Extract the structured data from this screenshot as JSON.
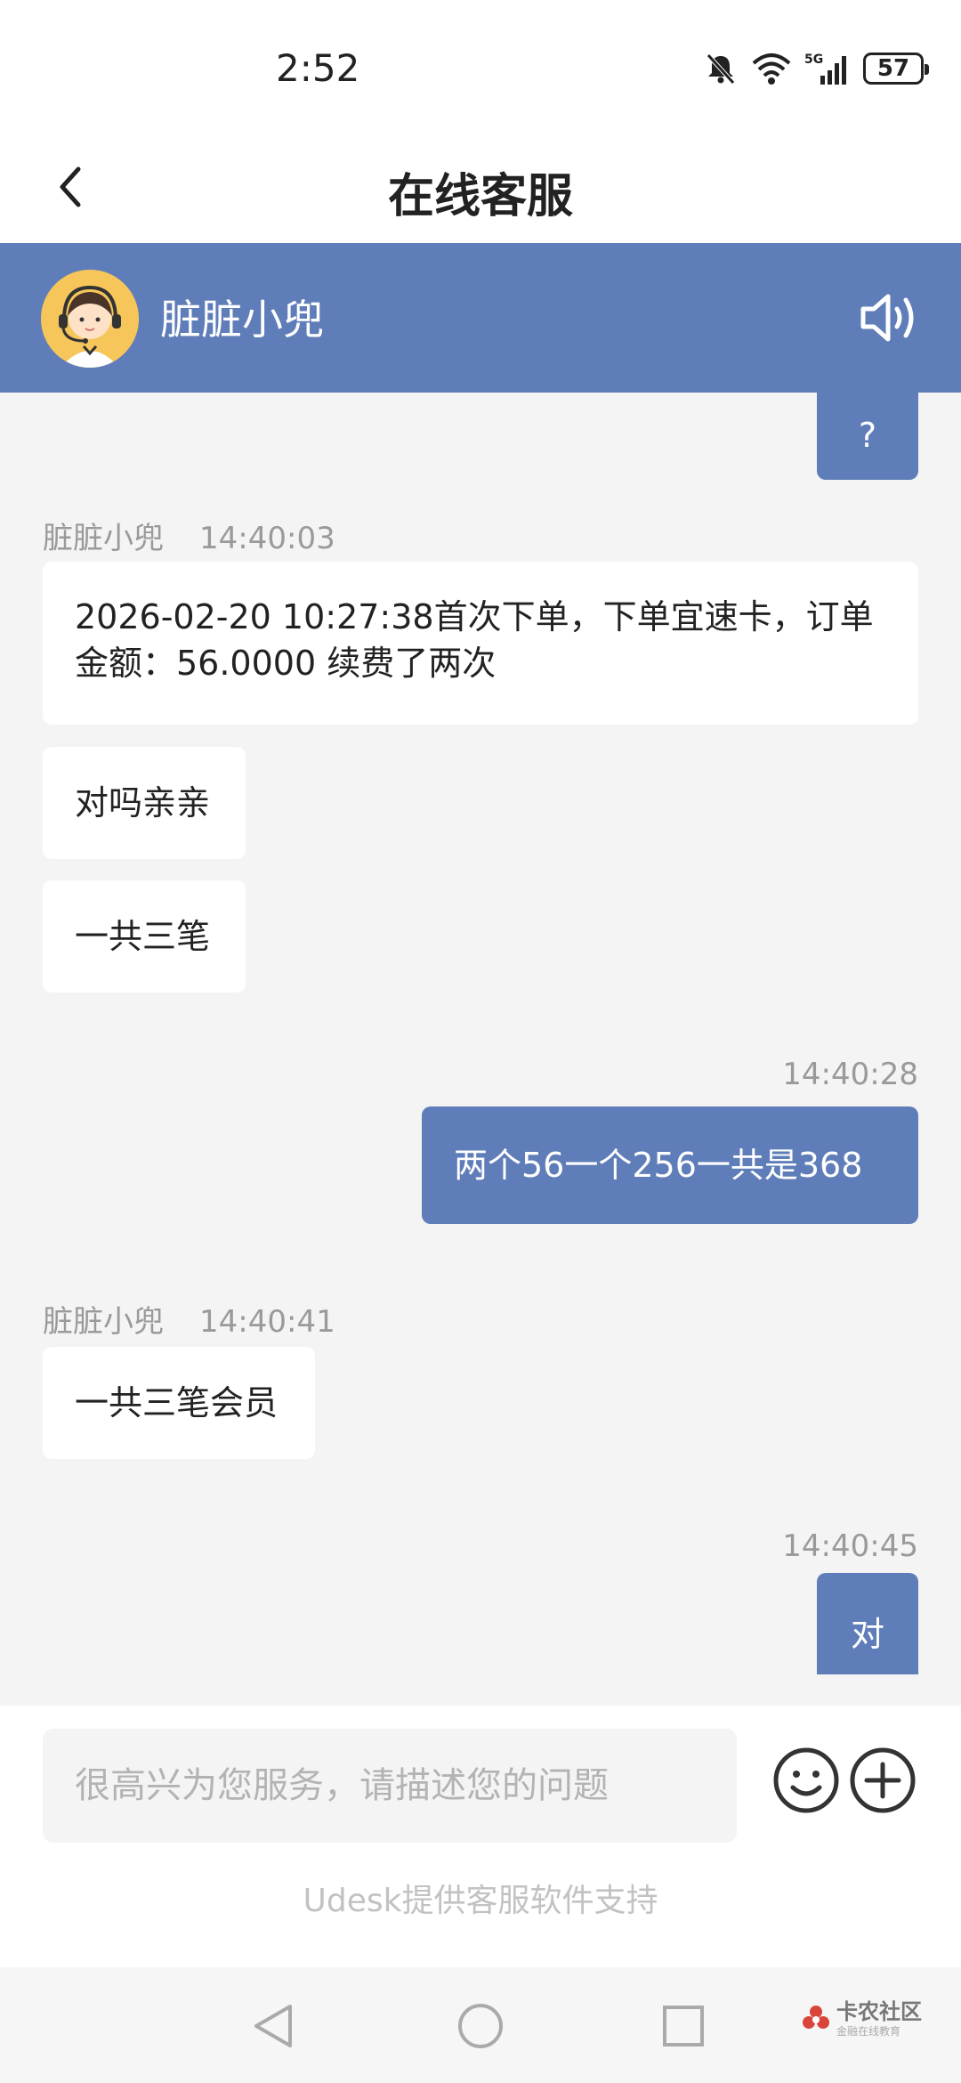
{
  "status": {
    "time": "2:52",
    "battery": "57",
    "network": "5G"
  },
  "header": {
    "title": "在线客服"
  },
  "agent": {
    "name": "脏脏小兜"
  },
  "messages": {
    "m0": {
      "text": "?"
    },
    "m1": {
      "sender": "脏脏小兜",
      "time": "14:40:03",
      "line1": "2026-02-20 10:27:38首次下单，下单宜速卡，订单",
      "line2": "金额：56.0000 续费了两次"
    },
    "m2": {
      "text": "对吗亲亲"
    },
    "m3": {
      "text": "一共三笔"
    },
    "m4": {
      "time": "14:40:28",
      "text": "两个56一个256一共是368"
    },
    "m5": {
      "sender": "脏脏小兜",
      "time": "14:40:41",
      "text": "一共三笔会员"
    },
    "m6": {
      "time": "14:40:45",
      "text": "对"
    }
  },
  "input": {
    "placeholder": "很高兴为您服务，请描述您的问题"
  },
  "footer": {
    "powered_by": "Udesk提供客服软件支持"
  },
  "watermark": {
    "main": "卡农社区",
    "sub": "金融在线教育"
  },
  "colors": {
    "accent": "#5f7db8",
    "background": "#f4f4f4",
    "bubble_in": "#ffffff"
  }
}
